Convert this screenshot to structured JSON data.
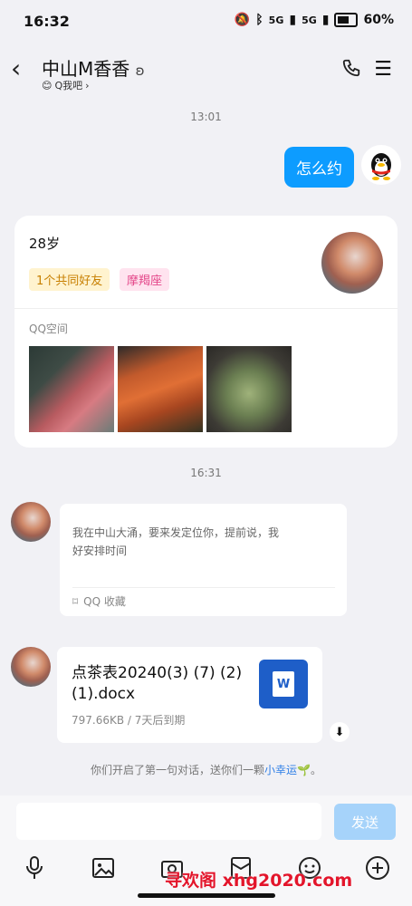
{
  "status": {
    "time": "16:32",
    "battery": "60%",
    "net1": "5G",
    "net2": "5G"
  },
  "header": {
    "title": "中山M香香",
    "subtitle": "Q我吧"
  },
  "time1": "13:01",
  "outgoing": {
    "text": "怎么约"
  },
  "card": {
    "age": "28岁",
    "tag_friend": "1个共同好友",
    "tag_sign": "摩羯座",
    "qzone": "QQ空间"
  },
  "time2": "16:31",
  "quote": {
    "text": "我在中山大涌，要来发定位你，提前说，我好安排时间",
    "source": "QQ 收藏"
  },
  "file": {
    "name": "点茶表20240(3) (7) (2) (1).docx",
    "meta": "797.66KB / 7天后到期",
    "icon": "W"
  },
  "tip": {
    "prefix": "你们开启了第一句对话，送你们一颗",
    "link": "小幸运",
    "suffix": "。"
  },
  "input": {
    "send": "发送"
  },
  "watermark": "寻欢阁 xhg2020.com"
}
